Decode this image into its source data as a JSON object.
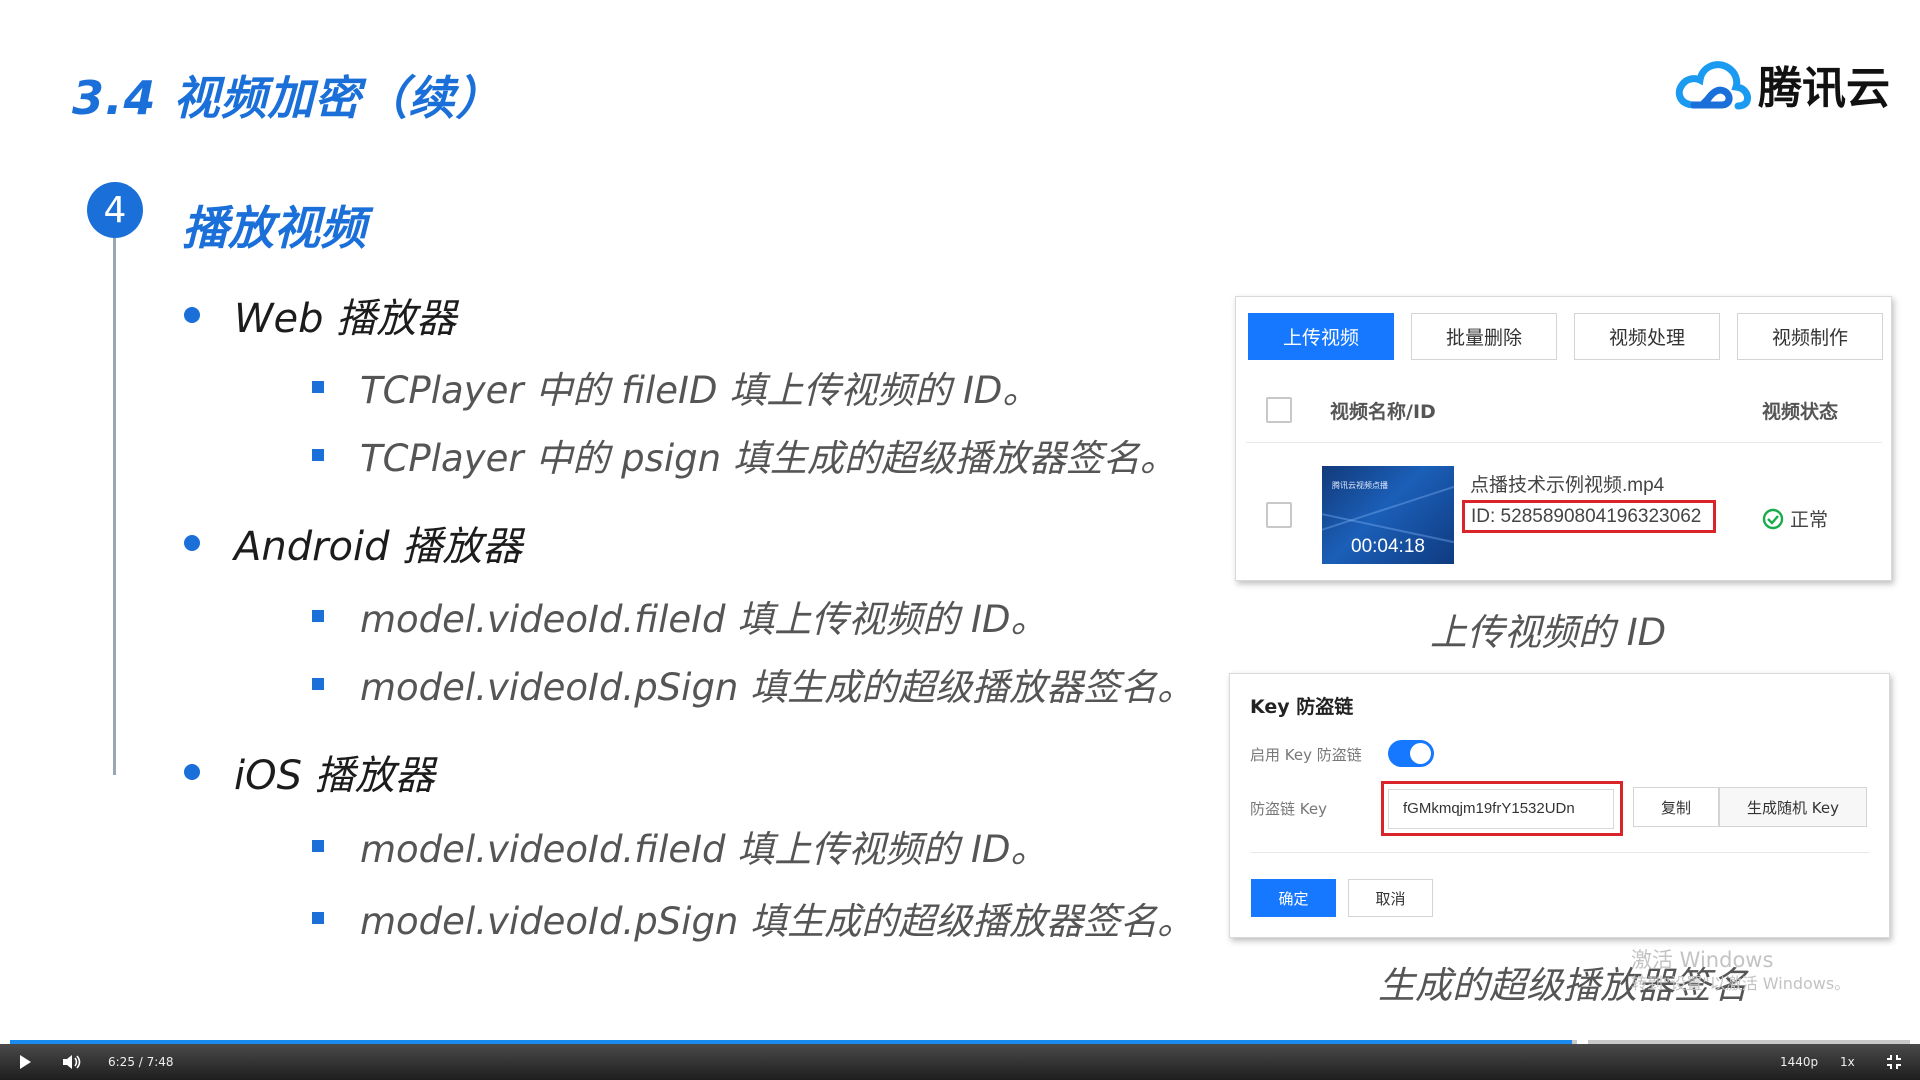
{
  "slide": {
    "title": "3.4 视频加密（续）",
    "logo_text": "腾讯云",
    "step_number": "4",
    "section_title": "播放视频"
  },
  "bullets": [
    {
      "label": "Web 播放器",
      "subs": [
        "TCPlayer 中的 fileID 填上传视频的 ID。",
        "TCPlayer 中的 psign 填生成的超级播放器签名。"
      ]
    },
    {
      "label": "Android 播放器",
      "subs": [
        "model.videoId.fileId 填上传视频的 ID。",
        "model.videoId.pSign 填生成的超级播放器签名。"
      ]
    },
    {
      "label": "iOS 播放器",
      "subs": [
        "model.videoId.fileId 填上传视频的 ID。",
        "model.videoId.pSign 填生成的超级播放器签名。"
      ]
    }
  ],
  "upload_panel": {
    "tabs": [
      "上传视频",
      "批量删除",
      "视频处理",
      "视频制作"
    ],
    "col_name": "视频名称/ID",
    "col_status": "视频状态",
    "thumb_caption": "腾讯云视频点播",
    "duration": "00:04:18",
    "file_name": "点播技术示例视频.mp4",
    "file_id": "ID: 5285890804196323062",
    "status": "正常",
    "caption": "上传视频的 ID"
  },
  "key_panel": {
    "title": "Key 防盗链",
    "enable_label": "启用 Key 防盗链",
    "enabled": true,
    "key_label": "防盗链 Key",
    "key_value": "fGMkmqjm19frY1532UDn",
    "copy_button": "复制",
    "generate_button": "生成随机 Key",
    "confirm_button": "确定",
    "cancel_button": "取消",
    "caption": "生成的超级播放器签名"
  },
  "watermark": {
    "line1": "激活 Windows",
    "line2": "转到\"设置\"以激活 Windows。"
  },
  "player": {
    "time": "6:25 / 7:48",
    "played_fraction": 0.822,
    "quality": "1440p",
    "speed": "1x"
  },
  "colors": {
    "accent": "#1a6fd8",
    "button_blue": "#1677ff",
    "highlight_red": "#d9242c",
    "progress": "#1a8cf0"
  }
}
